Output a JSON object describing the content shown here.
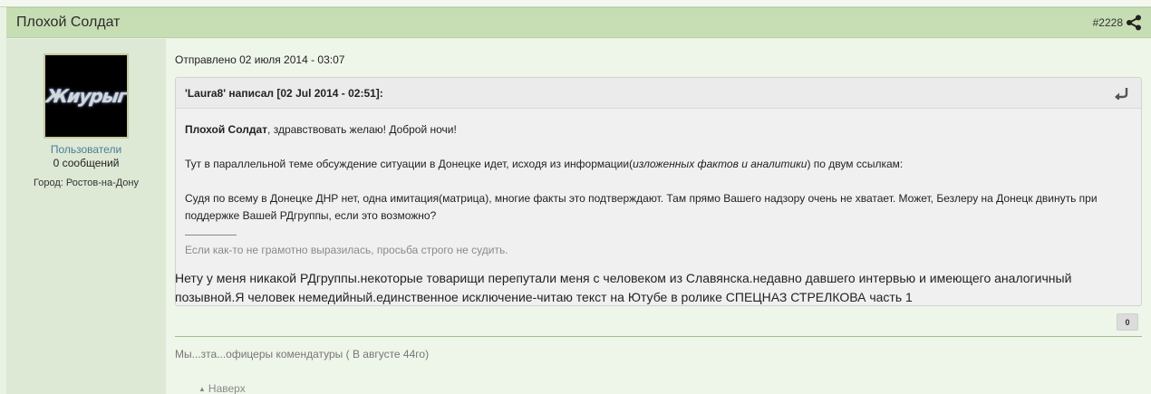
{
  "post": {
    "title": "Плохой Солдат",
    "number": "#2228",
    "share_icon": "share-icon"
  },
  "author": {
    "avatar_text": "Жиурыг",
    "group": "Пользователи",
    "posts_count": "0 сообщений",
    "city": "Город: Ростов-на-Дону"
  },
  "content": {
    "sent_date": "Отправлено 02 июля 2014 - 03:07",
    "quote": {
      "author": "'Laura8' написал [02 Jul 2014 - 02:51]:",
      "arrow_icon": "quote-return-icon",
      "p1_bold": "Плохой Солдат",
      "p1_rest": ", здравствовать желаю! Доброй ночи!",
      "p2_start": "Тут в параллельной теме обсуждение ситуации в Донецке идет, исходя из информации(",
      "p2_italic": "изложенных фактов и аналитики",
      "p2_end": ") по двум ссылкам:",
      "p3": "Судя по всему в Донецке ДНР нет, одна имитация(матрица), многие факты это подтверждают. Там прямо Вашего надзору очень не хватает. Может, Безлеру на Донецк двинуть при поддержке Вашей РДгруппы, если это возможно?",
      "signature": "Если как-то не грамотно выразилась, просьба строго не судить."
    },
    "reply": "Нету у меня никакой РДгруппы.некоторые товарищи перепутали меня с человеком из Славянска.недавно давшего интервью и имеющего аналогичный позывной.Я человек немедийный.единственное исключение-читаю текст на Ютубе в ролике СПЕЦНАЗ СТРЕЛКОВА часть 1",
    "reputation": "0",
    "user_signature": "Мы...зта...офицеры комендатуры ( В августе 44го)",
    "to_top": "Наверх"
  },
  "colors": {
    "header_bg": "#c7deb5",
    "sidebar_bg": "#dde8d5",
    "content_bg": "#eef5e9",
    "link": "#4a7f93"
  }
}
